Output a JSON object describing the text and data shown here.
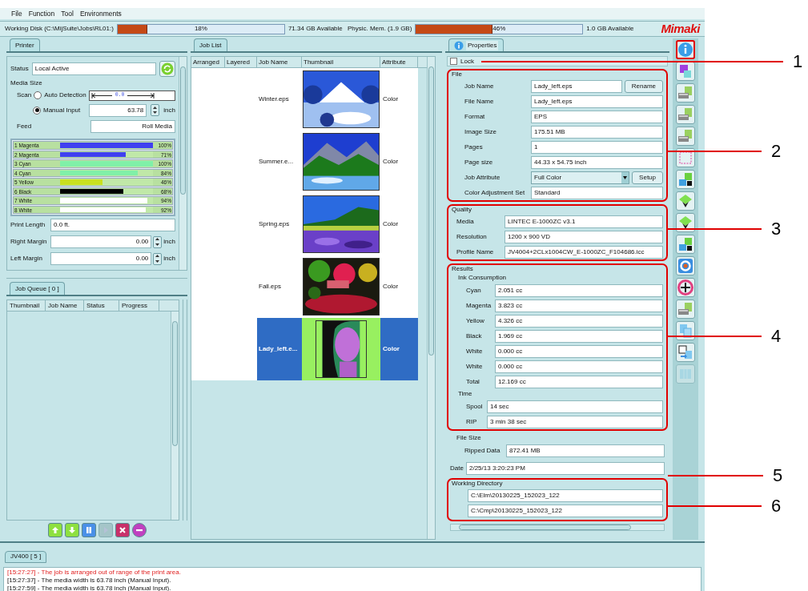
{
  "menu": [
    "File",
    "Function",
    "Tool",
    "Environments"
  ],
  "status_bar": {
    "disk": {
      "label": "Working Disk (C:\\MijSuite\\Jobs\\RL01:)",
      "level": 0.18,
      "reading": "18%",
      "available": "71.34 GB Available"
    },
    "memory": {
      "label": "Physic. Mem. (1.9 GB)",
      "level": 0.46,
      "reading": "46%",
      "available": "1.0 GB Available"
    },
    "logo": "Mimaki"
  },
  "printer": {
    "tab": "Printer",
    "status": {
      "label": "Status",
      "value": "Local Active"
    },
    "media_size": "Media Size",
    "scan_label": "Scan",
    "modes": [
      {
        "label": "Auto Detection",
        "selected": false,
        "reading": "0.0"
      },
      {
        "label": "Manual Input",
        "selected": true,
        "value": "63.78",
        "unit": "inch"
      }
    ],
    "feed": {
      "label": "Feed",
      "value": "Roll Media"
    },
    "inks": [
      {
        "label": "1 Magenta",
        "color": "#4040f0",
        "level": 1.0,
        "reading": "100%"
      },
      {
        "label": "2 Magenta",
        "color": "#4040f0",
        "level": 0.71,
        "reading": "71%"
      },
      {
        "label": "3 Cyan",
        "color": "#80f0a8",
        "level": 1.0,
        "reading": "100%"
      },
      {
        "label": "4 Cyan",
        "color": "#80f0a8",
        "level": 0.84,
        "reading": "84%"
      },
      {
        "label": "5 Yellow",
        "color": "#c8e020",
        "level": 0.46,
        "reading": "46%"
      },
      {
        "label": "6 Black",
        "color": "#000000",
        "level": 0.68,
        "reading": "68%"
      },
      {
        "label": "7 White",
        "color": "#ffffff",
        "level": 0.94,
        "reading": "94%"
      },
      {
        "label": "8 White",
        "color": "#ffffff",
        "level": 0.92,
        "reading": "92%"
      }
    ],
    "fields": [
      {
        "label": "Print Length",
        "value": "0.0 ft.",
        "kind": "text"
      },
      {
        "label": "Right Margin",
        "value": "0.00",
        "unit": "inch",
        "kind": "spin"
      },
      {
        "label": "Left Margin",
        "value": "0.00",
        "unit": "inch",
        "kind": "spin"
      }
    ]
  },
  "job_queue": {
    "tab": "Job Queue [ 0 ]",
    "columns": [
      "Thumbnail",
      "Job Name",
      "Status",
      "Progress"
    ],
    "buttons": [
      {
        "kind": "up",
        "disabled": false
      },
      {
        "kind": "down",
        "disabled": false
      },
      {
        "kind": "pause",
        "disabled": false
      },
      {
        "kind": "play",
        "disabled": true
      },
      {
        "kind": "cancel",
        "disabled": false
      },
      {
        "kind": "remove",
        "disabled": false
      }
    ]
  },
  "job_list": {
    "tab": "Job List",
    "columns": [
      "Arranged",
      "Layered",
      "Job Name",
      "Thumbnail",
      "Attribute"
    ],
    "rows": [
      {
        "name": "Winter.eps",
        "attribute": "Color",
        "selected": false
      },
      {
        "name": "Summer.e...",
        "attribute": "Color",
        "selected": false
      },
      {
        "name": "Spring.eps",
        "attribute": "Color",
        "selected": false
      },
      {
        "name": "Fall.eps",
        "attribute": "Color",
        "selected": false
      },
      {
        "name": "Lady_left.e...",
        "attribute": "Color",
        "selected": true
      }
    ]
  },
  "properties": {
    "tab": "Properties",
    "lock": {
      "label": "Lock",
      "checked": false,
      "callout": "1"
    },
    "file": {
      "title": "File",
      "callout": "2",
      "fields": [
        {
          "label": "Job Name",
          "value": "Lady_left.eps",
          "button": "Rename",
          "kind": "text"
        },
        {
          "label": "File Name",
          "value": "Lady_left.eps",
          "kind": "text"
        },
        {
          "label": "Format",
          "value": "EPS",
          "kind": "text"
        },
        {
          "label": "Image Size",
          "value": "175.51 MB",
          "kind": "text"
        },
        {
          "label": "Pages",
          "value": "1",
          "kind": "text"
        },
        {
          "label": "Page size",
          "value": "44.33 x 54.75 inch",
          "kind": "text"
        },
        {
          "label": "Job Attribute",
          "value": "Full Color",
          "button": "Setup",
          "kind": "select"
        },
        {
          "label": "Color Adjustment Set",
          "value": "Standard",
          "kind": "text"
        }
      ]
    },
    "quality": {
      "title": "Quality",
      "callout": "3",
      "fields": [
        {
          "label": "Media",
          "value": "LINTEC E-1000ZC v3.1"
        },
        {
          "label": "Resolution",
          "value": "1200 x 900 VD"
        },
        {
          "label": "Profile Name",
          "value": "JV4004+2CLx1004CW_E-1000ZC_F104686.icc"
        }
      ]
    },
    "results": {
      "title": "Results",
      "callout": "4",
      "sections": [
        {
          "title": "Ink Consumption",
          "fields": [
            {
              "label": "Cyan",
              "value": "2.051 cc"
            },
            {
              "label": "Magenta",
              "value": "3.823 cc"
            },
            {
              "label": "Yellow",
              "value": "4.326 cc"
            },
            {
              "label": "Black",
              "value": "1.969 cc"
            },
            {
              "label": "White",
              "value": "0.000 cc"
            },
            {
              "label": "White",
              "value": "0.000 cc"
            },
            {
              "label": "Total",
              "value": "12.169 cc"
            }
          ]
        },
        {
          "title": "Time",
          "fields": [
            {
              "label": "Spool",
              "value": "14 sec"
            },
            {
              "label": "RIP",
              "value": "3 min 38 sec"
            }
          ]
        }
      ]
    },
    "file_size": {
      "title": "File Size",
      "fields": [
        {
          "label": "Ripped Data",
          "value": "872.41 MB"
        }
      ]
    },
    "date": {
      "label": "Date",
      "value": "2/25/13 3:20:23 PM",
      "callout": "5"
    },
    "working_directory": {
      "title": "Working Directory",
      "callout": "6",
      "values": [
        "C:\\Elm\\20130225_152023_122",
        "C:\\Cmp\\20130225_152023_122"
      ]
    }
  },
  "toolbar": [
    {
      "kind": "info",
      "selected": true,
      "disabled": false
    },
    {
      "kind": "page",
      "selected": false,
      "disabled": false
    },
    {
      "kind": "printer",
      "selected": false,
      "disabled": false
    },
    {
      "kind": "printer",
      "selected": false,
      "disabled": false
    },
    {
      "kind": "printer",
      "selected": false,
      "disabled": false
    },
    {
      "kind": "frame",
      "selected": false,
      "disabled": false
    },
    {
      "kind": "swap",
      "selected": false,
      "disabled": false
    },
    {
      "kind": "layers",
      "selected": false,
      "disabled": false
    },
    {
      "kind": "layers",
      "selected": false,
      "disabled": false
    },
    {
      "kind": "swap",
      "selected": false,
      "disabled": false
    },
    {
      "kind": "ring",
      "selected": false,
      "disabled": false
    },
    {
      "kind": "wheel",
      "selected": false,
      "disabled": false
    },
    {
      "kind": "printer",
      "selected": false,
      "disabled": false
    },
    {
      "kind": "copy",
      "selected": false,
      "disabled": false
    },
    {
      "kind": "save",
      "selected": false,
      "disabled": false
    },
    {
      "kind": "columns",
      "selected": false,
      "disabled": true
    }
  ],
  "log": {
    "tab": "JV400 [ 5 ]",
    "lines": [
      {
        "text": "[15:27:27] - The job is arranged out of range of the print area.",
        "kind": "error"
      },
      {
        "text": "[15:27:37] - The media width is 63.78 inch (Manual Input).",
        "kind": "info"
      },
      {
        "text": "[15:27:59] - The media width is 63.78 inch (Manual Input).",
        "kind": "info"
      }
    ]
  }
}
